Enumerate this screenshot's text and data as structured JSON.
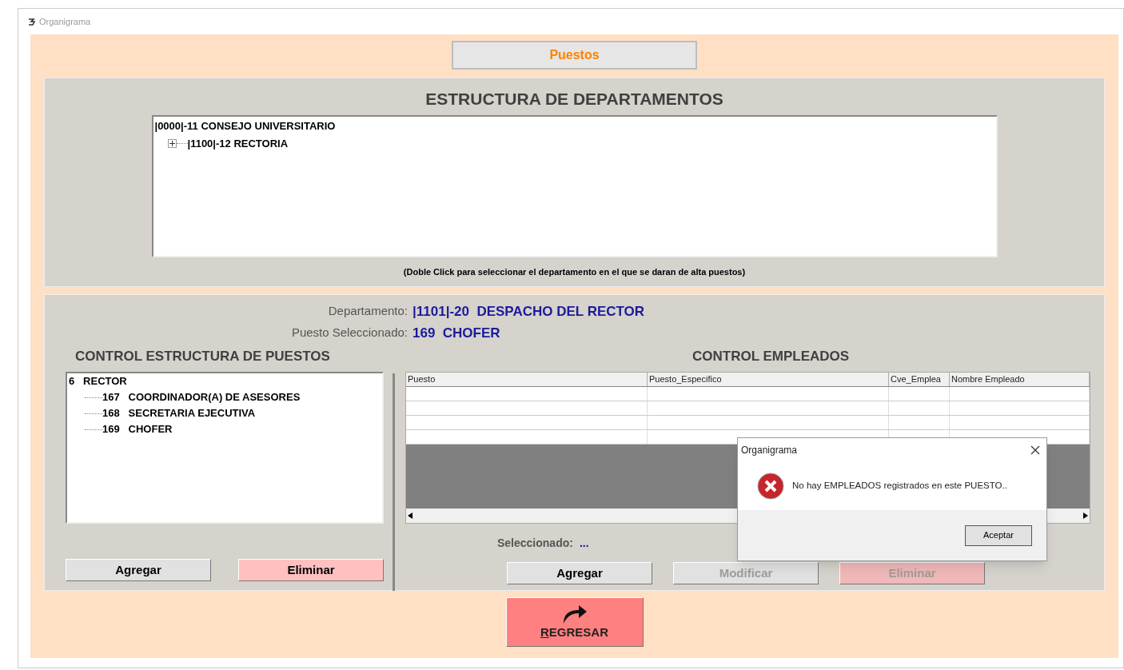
{
  "window": {
    "title": "Organigrama"
  },
  "header_tab": {
    "label": "Puestos"
  },
  "departments": {
    "title": "ESTRUCTURA DE DEPARTAMENTOS",
    "tree": [
      {
        "label": "|0000|-11  CONSEJO UNIVERSITARIO",
        "children": [
          {
            "label": "|1100|-12  RECTORIA",
            "expanded": false
          }
        ]
      }
    ],
    "hint": "(Doble Click para seleccionar el departamento en el que se daran de alta puestos)"
  },
  "info": [
    {
      "label": "Departamento:",
      "value": "|1101|-20  DESPACHO DEL RECTOR"
    },
    {
      "label": "Puesto Seleccionado:",
      "value": "169  CHOFER"
    }
  ],
  "positions": {
    "title": "CONTROL ESTRUCTURA DE PUESTOS",
    "tree": [
      {
        "code": "6",
        "name": "RECTOR",
        "children": [
          {
            "code": "167",
            "name": "COORDINADOR(A) DE ASESORES"
          },
          {
            "code": "168",
            "name": "SECRETARIA EJECUTIVA"
          },
          {
            "code": "169",
            "name": "CHOFER"
          }
        ]
      }
    ],
    "buttons": [
      {
        "label": "Agregar",
        "kind": "normal",
        "disabled": false
      },
      {
        "label": "Eliminar",
        "kind": "danger",
        "disabled": false
      }
    ]
  },
  "employees": {
    "title": "CONTROL EMPLEADOS",
    "columns": [
      "Puesto",
      "Puesto_Especifico",
      "Cve_Emplea",
      "Nombre Empleado"
    ],
    "selected_label": "Seleccionado:",
    "selected_value": "...",
    "buttons": [
      {
        "label": "Agregar",
        "kind": "normal",
        "disabled": false
      },
      {
        "label": "Modificar",
        "kind": "normal",
        "disabled": true
      },
      {
        "label": "Eliminar",
        "kind": "danger",
        "disabled": true
      }
    ]
  },
  "back_button": {
    "label": "REGRESAR"
  },
  "dialog": {
    "title": "Organigrama",
    "message": "No hay EMPLEADOS registrados en este PUESTO..",
    "button": "Aceptar"
  }
}
